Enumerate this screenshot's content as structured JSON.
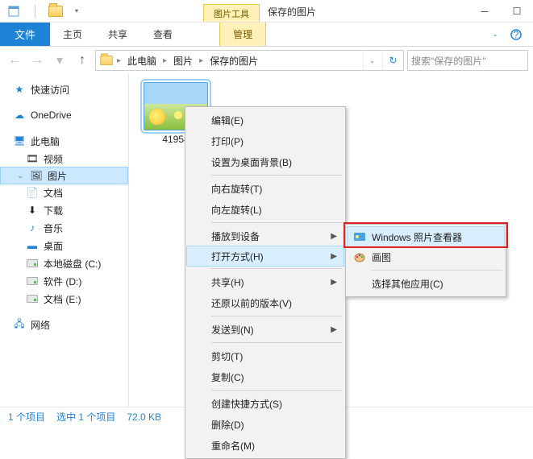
{
  "title_tool_tab": "图片工具",
  "title_text": "保存的图片",
  "ribbon": {
    "file": "文件",
    "home": "主页",
    "share": "共享",
    "view": "查看",
    "manage": "管理"
  },
  "breadcrumb": {
    "pc": "此电脑",
    "pictures": "图片",
    "saved": "保存的图片"
  },
  "search_placeholder": "搜索\"保存的图片\"",
  "tree": {
    "quick": "快速访问",
    "onedrive": "OneDrive",
    "pc": "此电脑",
    "videos": "视频",
    "pictures": "图片",
    "documents": "文档",
    "downloads": "下载",
    "music": "音乐",
    "desktop": "桌面",
    "drive_c": "本地磁盘 (C:)",
    "drive_d": "软件 (D:)",
    "drive_e": "文档 (E:)",
    "network": "网络"
  },
  "thumb_label": "41958",
  "context_menu": {
    "edit": "编辑(E)",
    "print": "打印(P)",
    "set_bg": "设置为桌面背景(B)",
    "rotate_r": "向右旋转(T)",
    "rotate_l": "向左旋转(L)",
    "cast": "播放到设备",
    "open_with": "打开方式(H)",
    "share": "共享(H)",
    "restore": "还原以前的版本(V)",
    "send_to": "发送到(N)",
    "cut": "剪切(T)",
    "copy": "复制(C)",
    "shortcut": "创建快捷方式(S)",
    "delete": "删除(D)",
    "rename": "重命名(M)"
  },
  "submenu": {
    "photo_viewer": "Windows 照片查看器",
    "paint": "画图",
    "choose_other": "选择其他应用(C)"
  },
  "status": {
    "items": "1 个项目",
    "selected": "选中 1 个项目",
    "size": "72.0 KB"
  }
}
